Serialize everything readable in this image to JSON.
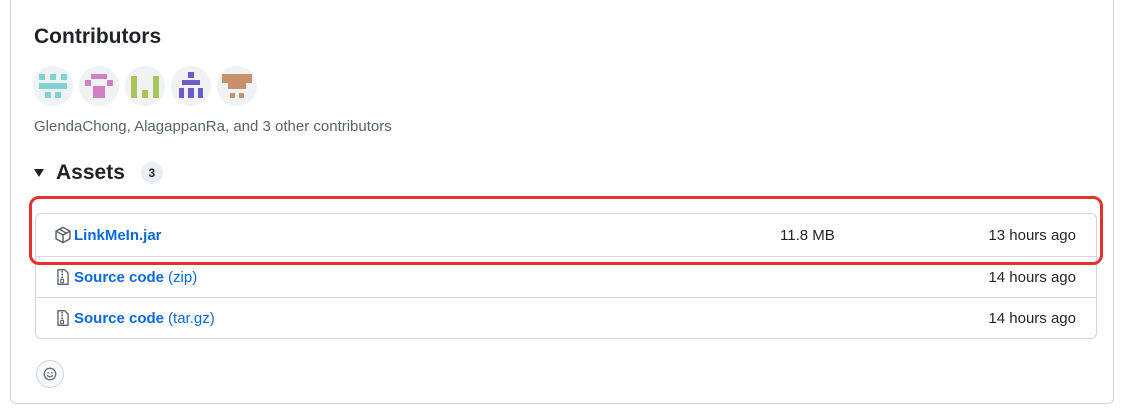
{
  "contributors": {
    "title": "Contributors",
    "summary": "GlendaChong, AlagappanRa, and 3 other contributors",
    "avatars": [
      {
        "icon": "identicon-avatar",
        "color": "#7fd3d1"
      },
      {
        "icon": "identicon-avatar",
        "color": "#d17fc8"
      },
      {
        "icon": "identicon-avatar",
        "color": "#a8c45a"
      },
      {
        "icon": "identicon-avatar",
        "color": "#6b5cc9"
      },
      {
        "icon": "identicon-avatar",
        "color": "#c9916b"
      }
    ]
  },
  "assets": {
    "title": "Assets",
    "count": "3",
    "items": [
      {
        "icon": "package-icon",
        "name": "LinkMeIn.jar",
        "suffix": "",
        "size": "11.8 MB",
        "time": "13 hours ago"
      },
      {
        "icon": "file-zip-icon",
        "name": "Source code",
        "suffix": "(zip)",
        "size": "",
        "time": "14 hours ago"
      },
      {
        "icon": "file-zip-icon",
        "name": "Source code",
        "suffix": "(tar.gz)",
        "size": "",
        "time": "14 hours ago"
      }
    ]
  },
  "highlight_color": "#e5312c",
  "reaction": {
    "icon": "smiley-icon"
  }
}
